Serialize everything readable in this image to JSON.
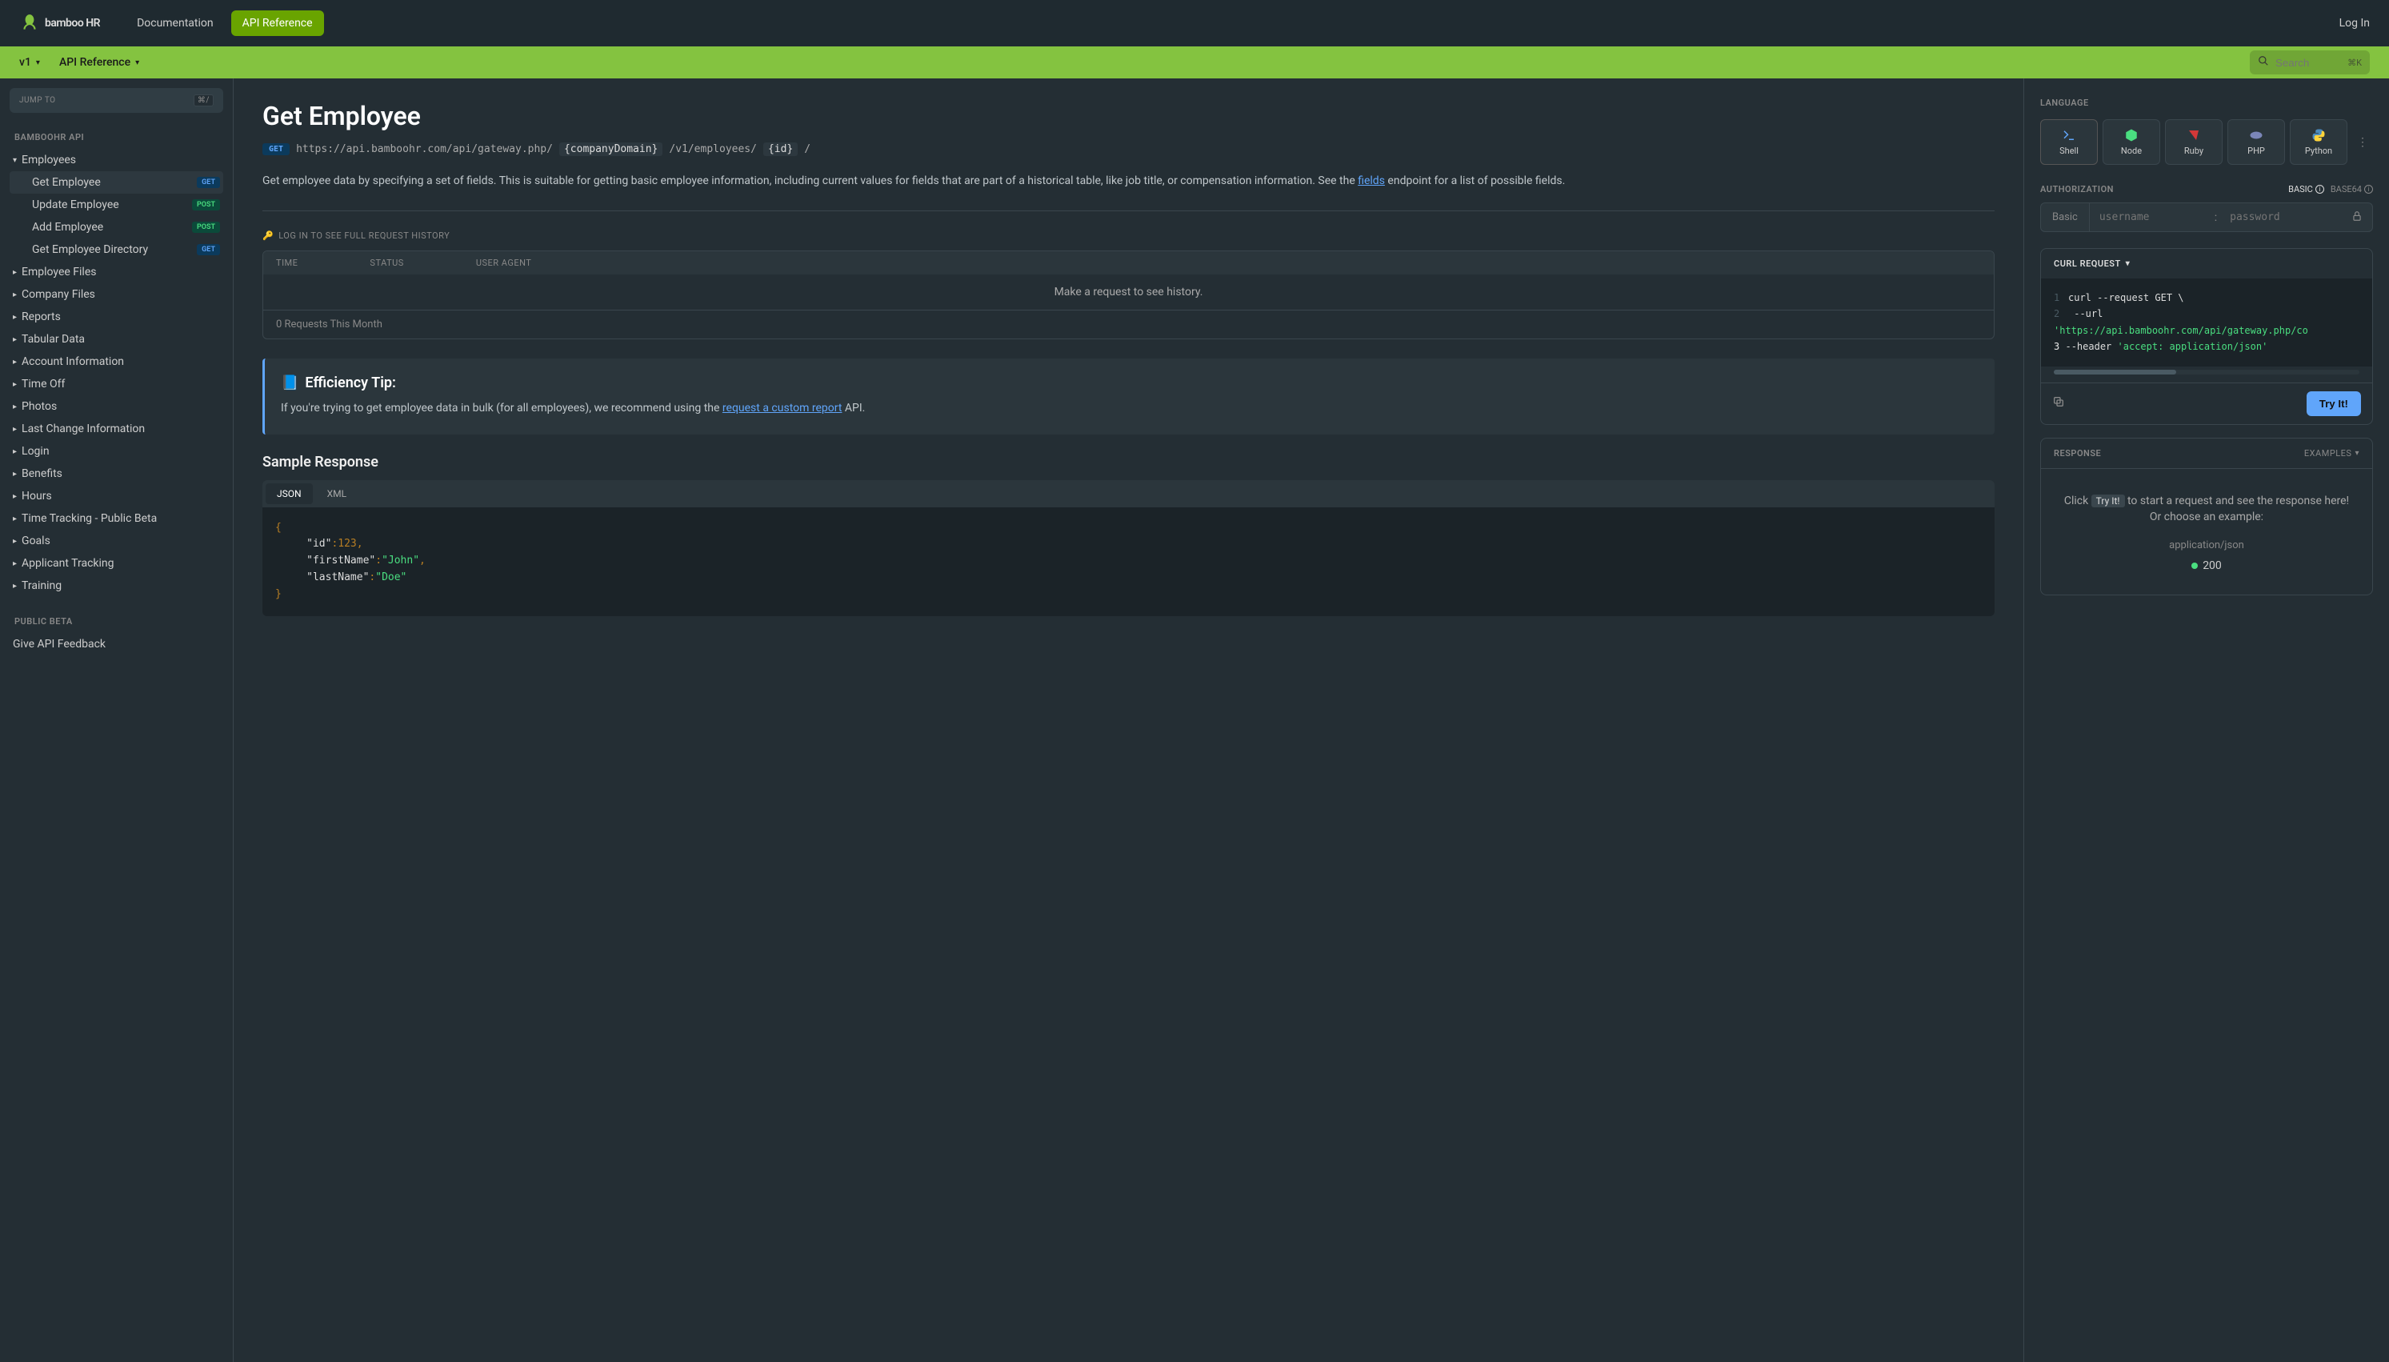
{
  "header": {
    "logo_text": "bamboo HR",
    "nav": {
      "documentation": "Documentation",
      "api_reference": "API Reference"
    },
    "login": "Log In"
  },
  "subheader": {
    "version": "v1",
    "api_reference": "API Reference",
    "search_placeholder": "Search",
    "search_shortcut": "⌘K"
  },
  "sidebar": {
    "jump_to": "JUMP TO",
    "jump_kbd": "⌘/",
    "section_title": "BAMBOOHR API",
    "employees": "Employees",
    "employees_children": [
      {
        "label": "Get Employee",
        "badge": "GET",
        "active": true
      },
      {
        "label": "Update Employee",
        "badge": "POST"
      },
      {
        "label": "Add Employee",
        "badge": "POST"
      },
      {
        "label": "Get Employee Directory",
        "badge": "GET"
      }
    ],
    "items": [
      "Employee Files",
      "Company Files",
      "Reports",
      "Tabular Data",
      "Account Information",
      "Time Off",
      "Photos",
      "Last Change Information",
      "Login",
      "Benefits",
      "Hours",
      "Time Tracking - Public Beta",
      "Goals",
      "Applicant Tracking",
      "Training"
    ],
    "public_beta_title": "PUBLIC BETA",
    "give_feedback": "Give API Feedback"
  },
  "doc": {
    "title": "Get Employee",
    "method": "GET",
    "url_prefix": "https://api.bamboohr.com/api/gateway.php/",
    "url_param1": "{companyDomain}",
    "url_mid": "/v1/employees/",
    "url_param2": "{id}",
    "url_suffix": "/",
    "para1a": "Get employee data by specifying a set of fields. This is suitable for getting basic employee information, including current values for fields that are part of a historical table, like job title, or compensation information. See the ",
    "fields_link": "fields",
    "para1b": " endpoint for a list of possible fields.",
    "history_link": "LOG IN TO SEE FULL REQUEST HISTORY",
    "table": {
      "headers": [
        "TIME",
        "STATUS",
        "USER AGENT"
      ],
      "empty": "Make a request to see history."
    },
    "requests_this_month": "0 Requests This Month",
    "tip_emoji": "📘",
    "tip_title": "Efficiency Tip:",
    "tip_body_a": "If you're trying to get employee data in bulk (for all employees), we recommend using the ",
    "tip_link": "request a custom report",
    "tip_body_b": " API.",
    "sample_response": "Sample Response",
    "tabs": {
      "json": "JSON",
      "xml": "XML"
    },
    "code": {
      "id_key": "\"id\"",
      "id_val": "123",
      "first_key": "\"firstName\"",
      "first_val": "\"John\"",
      "last_key": "\"lastName\"",
      "last_val": "\"Doe\""
    }
  },
  "panel": {
    "language_label": "LANGUAGE",
    "languages": [
      "Shell",
      "Node",
      "Ruby",
      "PHP",
      "Python"
    ],
    "authorization_label": "AUTHORIZATION",
    "auth_modes": {
      "basic": "BASIC",
      "base64": "BASE64"
    },
    "auth_basic_label": "Basic",
    "username_placeholder": "username",
    "password_placeholder": "password",
    "curl_request": "CURL REQUEST",
    "curl_lines": {
      "l1a": "curl ",
      "l1b": "--request",
      "l1c": " GET \\",
      "l2a": "--url",
      "l2b": " 'https://api.bamboohr.com/api/gateway.php/co",
      "l3a": "--header",
      "l3b": " 'accept: application/json'"
    },
    "try_it": "Try It!",
    "response_label": "RESPONSE",
    "examples": "EXAMPLES",
    "resp_line1a": "Click ",
    "resp_try_chip": "Try It!",
    "resp_line1b": " to start a request and see the response here!",
    "resp_line2": "Or choose an example:",
    "mime": "application/json",
    "status_code": "200"
  }
}
